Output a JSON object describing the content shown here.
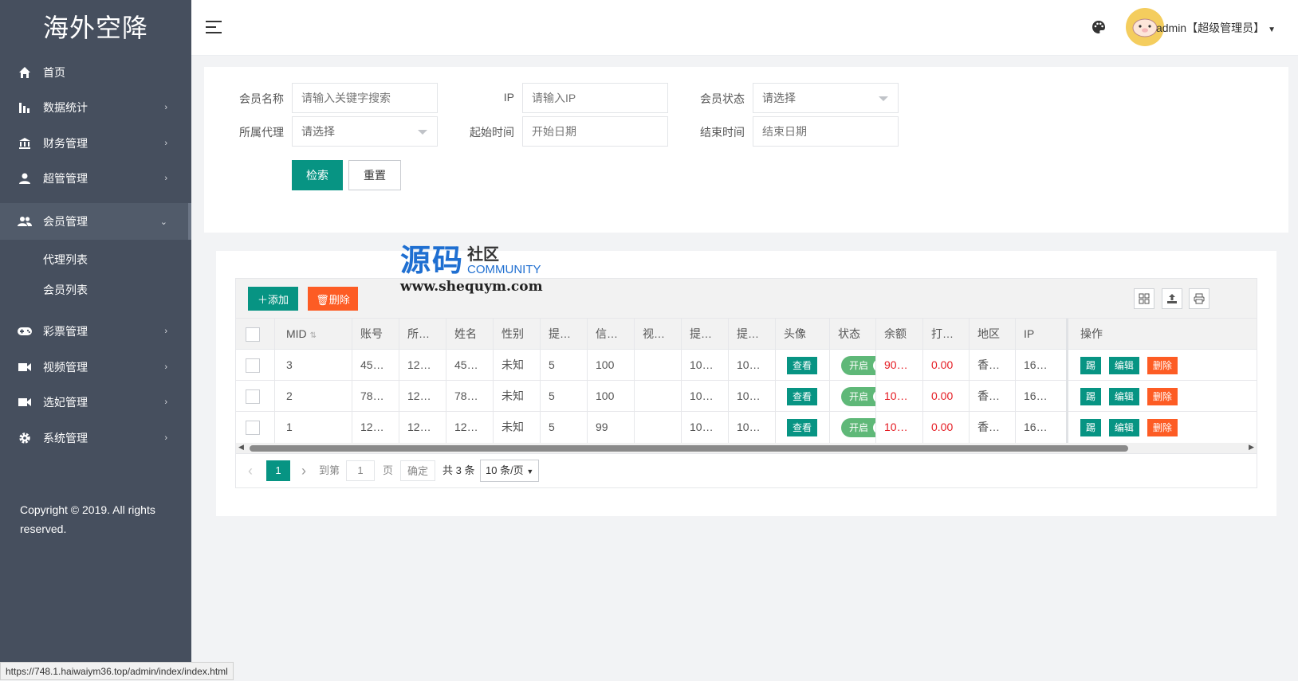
{
  "app": {
    "title": "海外空降"
  },
  "sidebar": {
    "items": [
      {
        "label": "首页",
        "icon": "home-icon"
      },
      {
        "label": "数据统计",
        "icon": "bar-chart-icon"
      },
      {
        "label": "财务管理",
        "icon": "bank-icon"
      },
      {
        "label": "超管管理",
        "icon": "user-icon"
      },
      {
        "label": "会员管理",
        "icon": "users-icon"
      },
      {
        "label": "彩票管理",
        "icon": "gamepad-icon"
      },
      {
        "label": "视频管理",
        "icon": "video-icon"
      },
      {
        "label": "选妃管理",
        "icon": "video-icon"
      },
      {
        "label": "系统管理",
        "icon": "gear-icon"
      }
    ],
    "subitems": [
      "代理列表",
      "会员列表"
    ],
    "copyright": "Copyright © 2019. All rights reserved."
  },
  "header": {
    "user": "admin【超级管理员】"
  },
  "search": {
    "member_name_label": "会员名称",
    "member_name_placeholder": "请输入关键字搜索",
    "ip_label": "IP",
    "ip_placeholder": "请输入IP",
    "status_label": "会员状态",
    "status_value": "请选择",
    "agent_label": "所属代理",
    "agent_value": "请选择",
    "start_label": "起始时间",
    "start_placeholder": "开始日期",
    "end_label": "结束时间",
    "end_placeholder": "结束日期",
    "search_btn": "检索",
    "reset_btn": "重置"
  },
  "toolbar": {
    "add": "添加",
    "delete": "删除"
  },
  "watermark": {
    "main": "源码",
    "sub": "社区",
    "en": "COMMUNITY",
    "url": "www.shequym.com"
  },
  "table": {
    "headers": [
      "MID",
      "账号",
      "所…",
      "姓名",
      "性别",
      "提…",
      "信…",
      "视…",
      "提…",
      "提…",
      "头像",
      "状态",
      "余额",
      "打…",
      "地区",
      "IP",
      "操作"
    ],
    "rows": [
      {
        "mid": "3",
        "account": "45…",
        "agent": "12…",
        "name": "45…",
        "gender": "未知",
        "c5": "5",
        "credit": "100",
        "c7": "",
        "c8": "10…",
        "c9": "10…",
        "avatar": "查看",
        "status": "开启",
        "balance": "90…",
        "c13": "0.00",
        "region": "香…",
        "ip": "16…"
      },
      {
        "mid": "2",
        "account": "78…",
        "agent": "12…",
        "name": "78…",
        "gender": "未知",
        "c5": "5",
        "credit": "100",
        "c7": "",
        "c8": "10…",
        "c9": "10…",
        "avatar": "查看",
        "status": "开启",
        "balance": "10…",
        "c13": "0.00",
        "region": "香…",
        "ip": "16…"
      },
      {
        "mid": "1",
        "account": "12…",
        "agent": "12…",
        "name": "12…",
        "gender": "未知",
        "c5": "5",
        "credit": "99",
        "c7": "",
        "c8": "10…",
        "c9": "10…",
        "avatar": "查看",
        "status": "开启",
        "balance": "10…",
        "c13": "0.00",
        "region": "香…",
        "ip": "16…"
      }
    ],
    "actions": [
      "踢",
      "编辑",
      "删除"
    ]
  },
  "pager": {
    "current": "1",
    "goto": "到第",
    "page_input": "1",
    "page_unit": "页",
    "confirm": "确定",
    "total": "共 3 条",
    "per_page": "10 条/页"
  },
  "statusbar": {
    "url": "https://748.1.haiwaiym36.top/admin/index/index.html"
  }
}
